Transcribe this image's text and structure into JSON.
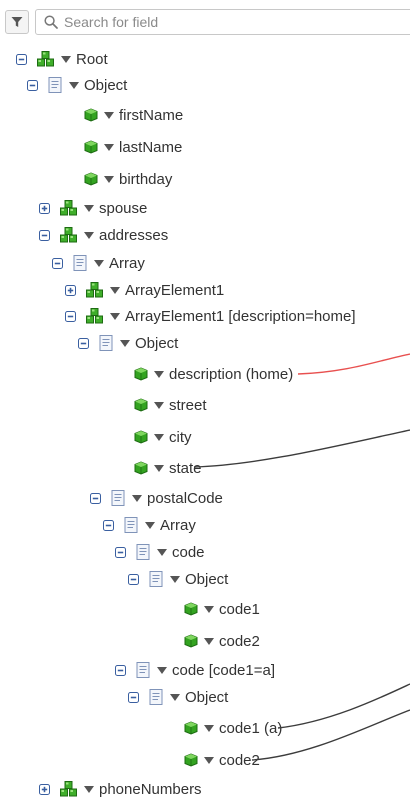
{
  "search": {
    "placeholder": "Search for field",
    "value": ""
  },
  "tree": [
    {
      "label": "Root",
      "icon": "package-icon",
      "toggle": "minus"
    },
    {
      "label": "Object",
      "icon": "object-icon",
      "toggle": "minus"
    },
    {
      "label": "firstName",
      "icon": "field-icon",
      "toggle": "none"
    },
    {
      "label": "lastName",
      "icon": "field-icon",
      "toggle": "none"
    },
    {
      "label": "birthday",
      "icon": "field-icon",
      "toggle": "none"
    },
    {
      "label": "spouse",
      "icon": "package-icon",
      "toggle": "plus"
    },
    {
      "label": "addresses",
      "icon": "package-icon",
      "toggle": "minus"
    },
    {
      "label": "Array",
      "icon": "object-icon",
      "toggle": "minus"
    },
    {
      "label": "ArrayElement1",
      "icon": "package-icon",
      "toggle": "plus"
    },
    {
      "label": "ArrayElement1 [description=home]",
      "icon": "package-icon",
      "toggle": "minus"
    },
    {
      "label": "Object",
      "icon": "object-icon",
      "toggle": "minus"
    },
    {
      "label": "description (home)",
      "icon": "field-icon",
      "toggle": "none"
    },
    {
      "label": "street",
      "icon": "field-icon",
      "toggle": "none"
    },
    {
      "label": "city",
      "icon": "field-icon",
      "toggle": "none"
    },
    {
      "label": "state",
      "icon": "field-icon",
      "toggle": "none"
    },
    {
      "label": "postalCode",
      "icon": "object-icon",
      "toggle": "minus"
    },
    {
      "label": "Array",
      "icon": "object-icon",
      "toggle": "minus"
    },
    {
      "label": "code",
      "icon": "object-icon",
      "toggle": "minus"
    },
    {
      "label": "Object",
      "icon": "object-icon",
      "toggle": "minus"
    },
    {
      "label": "code1",
      "icon": "field-icon",
      "toggle": "none"
    },
    {
      "label": "code2",
      "icon": "field-icon",
      "toggle": "none"
    },
    {
      "label": "code [code1=a]",
      "icon": "object-icon",
      "toggle": "minus"
    },
    {
      "label": "Object",
      "icon": "object-icon",
      "toggle": "minus"
    },
    {
      "label": "code1 (a)",
      "icon": "field-icon",
      "toggle": "none"
    },
    {
      "label": "code2",
      "icon": "field-icon",
      "toggle": "none"
    },
    {
      "label": "phoneNumbers",
      "icon": "package-icon",
      "toggle": "plus"
    }
  ],
  "colors": {
    "mapping_red": "#e8504f",
    "mapping_dark": "#3c3c3c",
    "field_green": "#33a320",
    "toggle_blue": "#3a5fa0"
  }
}
